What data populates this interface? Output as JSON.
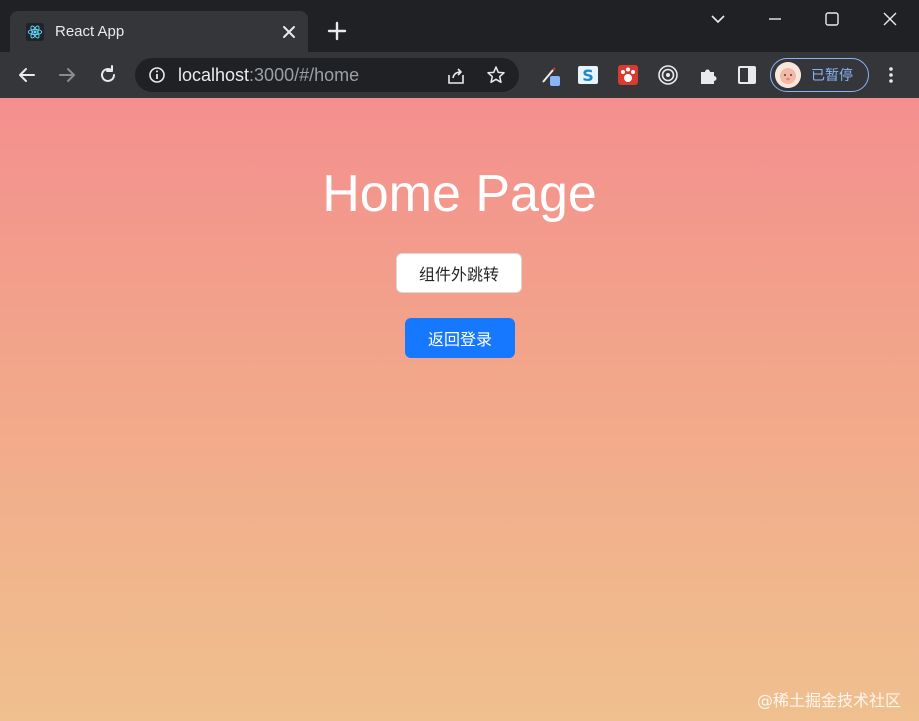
{
  "browser": {
    "tab": {
      "title": "React App",
      "favicon": "react-logo-icon",
      "close_icon": "close-icon"
    },
    "new_tab_icon": "plus-icon",
    "window_controls": [
      "chevron-down-icon",
      "minimize-icon",
      "maximize-icon",
      "close-icon"
    ],
    "nav": [
      "back-arrow-icon",
      "forward-arrow-icon",
      "reload-icon"
    ],
    "address": {
      "host": "localhost",
      "path": ":3000/#/home",
      "info_icon": "info-icon"
    },
    "omnibox_actions": [
      "share-icon",
      "star-icon"
    ],
    "extensions": [
      "color-picker-icon",
      "s-extension-icon",
      "paw-extension-icon",
      "target-icon",
      "puzzle-icon",
      "side-panel-icon"
    ],
    "profile": {
      "label": "已暂停"
    },
    "menu_icon": "more-vert-icon"
  },
  "page": {
    "title": "Home Page",
    "buttons": {
      "external_jump": "组件外跳转",
      "back_login": "返回登录"
    },
    "watermark": "@稀土掘金技术社区"
  },
  "colors": {
    "gradient_top": "#f48f8f",
    "gradient_bottom": "#f0c08e",
    "primary": "#1677ff",
    "chrome_dark": "#202124",
    "chrome_toolbar": "#35363a",
    "accent_blue": "#8ab4f8"
  }
}
